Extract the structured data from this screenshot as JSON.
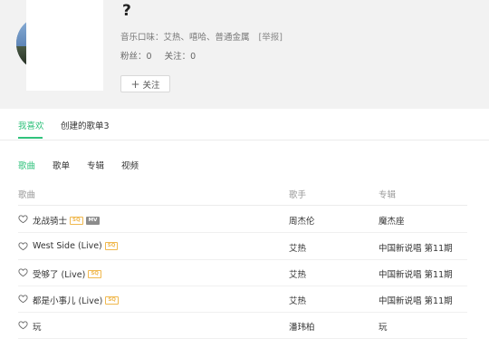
{
  "profile": {
    "nickname": "?",
    "music_taste_label": "音乐口味：",
    "music_taste_value": "艾热、嘻哈、普通金属",
    "report_link": "[举报]",
    "fans_label": "粉丝：",
    "fans_count": "0",
    "following_label": "关注：",
    "following_count": "0",
    "follow_button": "关注"
  },
  "main_tabs": [
    {
      "label": "我喜欢",
      "active": true
    },
    {
      "label": "创建的歌单3",
      "active": false
    }
  ],
  "sub_tabs": [
    {
      "label": "歌曲",
      "active": true
    },
    {
      "label": "歌单",
      "active": false
    },
    {
      "label": "专辑",
      "active": false
    },
    {
      "label": "视频",
      "active": false
    }
  ],
  "table": {
    "columns": [
      "歌曲",
      "歌手",
      "专辑"
    ],
    "rows": [
      {
        "song": "龙战骑士",
        "badges": [
          "SQ",
          "MV"
        ],
        "singer": "周杰伦",
        "album": "魔杰座"
      },
      {
        "song": "West Side (Live)",
        "badges": [
          "SQ"
        ],
        "singer": "艾热",
        "album": "中国新说唱 第11期"
      },
      {
        "song": "受够了 (Live)",
        "badges": [
          "SQ"
        ],
        "singer": "艾热",
        "album": "中国新说唱 第11期"
      },
      {
        "song": "都是小事儿 (Live)",
        "badges": [
          "SQ"
        ],
        "singer": "艾热",
        "album": "中国新说唱 第11期"
      },
      {
        "song": "玩",
        "badges": [],
        "singer": "潘玮柏",
        "album": "玩"
      }
    ]
  },
  "colors": {
    "accent": "#31c27c",
    "sq_badge": "#f0b84e",
    "mv_badge": "#8c8c8c",
    "header_bg": "#f2f2f2"
  },
  "icons": {
    "follow": "plus-icon",
    "like": "heart-outline-icon"
  }
}
